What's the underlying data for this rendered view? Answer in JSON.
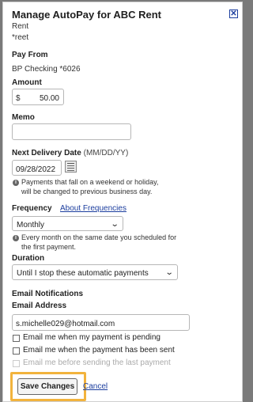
{
  "dialog": {
    "title": "Manage AutoPay for ABC Rent",
    "close_icon": "close-icon",
    "payee_name": "Rent",
    "payee_account": "*reet"
  },
  "pay_from": {
    "label": "Pay From",
    "value": "BP Checking *6026"
  },
  "amount": {
    "label": "Amount",
    "prefix": "$",
    "value": "50.00"
  },
  "memo": {
    "label": "Memo",
    "value": ""
  },
  "delivery": {
    "label": "Next Delivery Date",
    "format": "(MM/DD/YY)",
    "value": "09/28/2022",
    "calendar_icon": "calendar-icon",
    "note_line1": "Payments that fall on a weekend or holiday,",
    "note_line2": "will be changed to previous business day."
  },
  "frequency": {
    "label": "Frequency",
    "link": "About Frequencies",
    "selected": "Monthly",
    "note_line1": "Every month on the same date you scheduled for",
    "note_line2": "the first payment."
  },
  "duration": {
    "label": "Duration",
    "selected": "Until I stop these automatic payments"
  },
  "notifications": {
    "heading": "Email Notifications",
    "email_label": "Email Address",
    "email_value": "s.michelle029@hotmail.com",
    "options": [
      {
        "label": "Email me when my payment is pending",
        "checked": false,
        "enabled": true
      },
      {
        "label": "Email me when the payment has been sent",
        "checked": false,
        "enabled": true
      },
      {
        "label": "Email me before sending the last payment",
        "checked": false,
        "enabled": false
      }
    ]
  },
  "actions": {
    "save_label": "Save Changes",
    "cancel_label": "Cancel"
  },
  "colors": {
    "link": "#1b3d9e",
    "highlight": "#f2b33d",
    "backdrop": "#7a7a7a"
  }
}
